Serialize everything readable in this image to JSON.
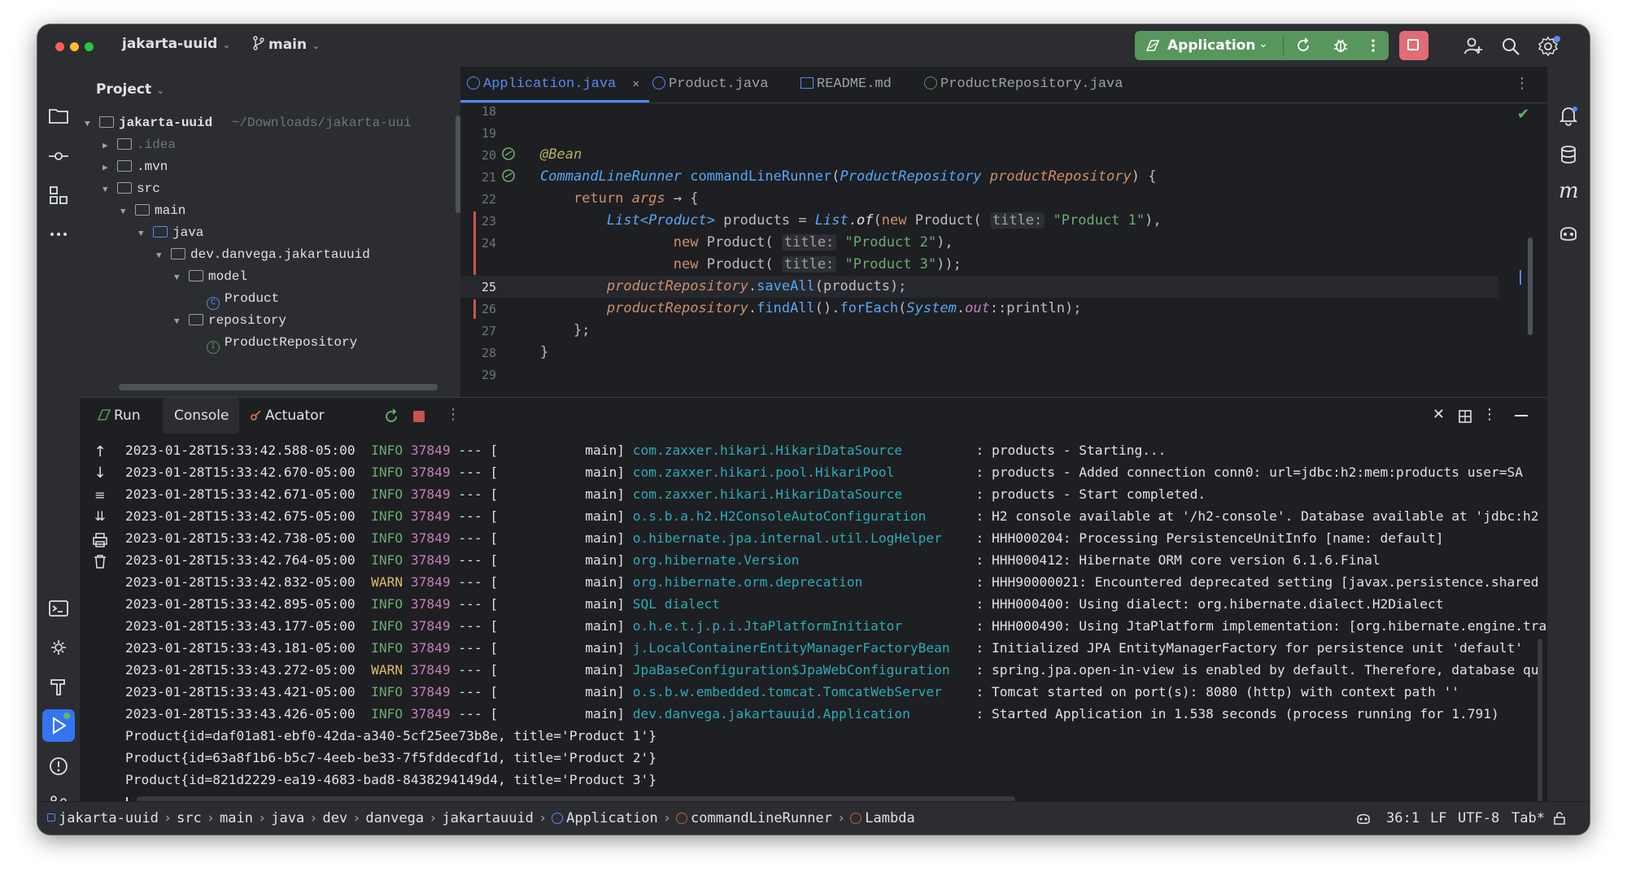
{
  "titlebar": {
    "project_name": "jakarta-uuid",
    "branch": "main",
    "run_config": "Application"
  },
  "project_pane": {
    "title": "Project",
    "root_name": "jakarta-uuid",
    "root_path": "~/Downloads/jakarta-uui",
    "items": [
      {
        "label": ".idea"
      },
      {
        "label": ".mvn"
      },
      {
        "label": "src"
      },
      {
        "label": "main"
      },
      {
        "label": "java"
      },
      {
        "label": "dev.danvega.jakartauuid"
      },
      {
        "label": "model"
      },
      {
        "label": "Product"
      },
      {
        "label": "repository"
      },
      {
        "label": "ProductRepository"
      }
    ]
  },
  "editor": {
    "tabs": [
      {
        "label": "Application.java"
      },
      {
        "label": "Product.java"
      },
      {
        "label": "README.md"
      },
      {
        "label": "ProductRepository.java"
      }
    ],
    "line_numbers": [
      "18",
      "19",
      "20",
      "21",
      "22",
      "23",
      "24",
      "25",
      "26",
      "27",
      "28",
      "29"
    ],
    "code": {
      "l19": "@Bean",
      "l20_type": "CommandLineRunner",
      "l20_fn": "commandLineRunner",
      "l20_paramtype": "ProductRepository",
      "l20_param": "productRepository",
      "l21_kw": "return",
      "l21_args": "args",
      "l22_type": "List<Product>",
      "l22_var": "products",
      "l22_list": "List",
      "l22_of": "of",
      "hint_title": "title:",
      "p1": "\"Product 1\"",
      "p2": "\"Product 2\"",
      "p3": "\"Product 3\"",
      "new_kw": "new",
      "product_cls": "Product",
      "l25_recv": "productRepository",
      "l25_call": "saveAll",
      "l25_arg": "products",
      "l26_recv": "productRepository",
      "l26_findall": "findAll",
      "l26_foreach": "forEach",
      "l26_system": "System",
      "l26_out": "out",
      "l26_println": "println"
    }
  },
  "toolwindow": {
    "tabs": [
      {
        "label": "Run"
      },
      {
        "label": "Console"
      },
      {
        "label": "Actuator"
      }
    ],
    "log_lines": [
      {
        "ts": "2023-01-28T15:33:42.588-05:00",
        "level": "INFO",
        "pid": "37849",
        "thread": "main",
        "logger": "com.zaxxer.hikari.HikariDataSource",
        "msg": ": products - Starting..."
      },
      {
        "ts": "2023-01-28T15:33:42.670-05:00",
        "level": "INFO",
        "pid": "37849",
        "thread": "main",
        "logger": "com.zaxxer.hikari.pool.HikariPool",
        "msg": ": products - Added connection conn0: url=jdbc:h2:mem:products user=SA"
      },
      {
        "ts": "2023-01-28T15:33:42.671-05:00",
        "level": "INFO",
        "pid": "37849",
        "thread": "main",
        "logger": "com.zaxxer.hikari.HikariDataSource",
        "msg": ": products - Start completed."
      },
      {
        "ts": "2023-01-28T15:33:42.675-05:00",
        "level": "INFO",
        "pid": "37849",
        "thread": "main",
        "logger": "o.s.b.a.h2.H2ConsoleAutoConfiguration",
        "msg": ": H2 console available at '/h2-console'. Database available at 'jdbc:h2"
      },
      {
        "ts": "2023-01-28T15:33:42.738-05:00",
        "level": "INFO",
        "pid": "37849",
        "thread": "main",
        "logger": "o.hibernate.jpa.internal.util.LogHelper",
        "msg": ": HHH000204: Processing PersistenceUnitInfo [name: default]"
      },
      {
        "ts": "2023-01-28T15:33:42.764-05:00",
        "level": "INFO",
        "pid": "37849",
        "thread": "main",
        "logger": "org.hibernate.Version",
        "msg": ": HHH000412: Hibernate ORM core version 6.1.6.Final"
      },
      {
        "ts": "2023-01-28T15:33:42.832-05:00",
        "level": "WARN",
        "pid": "37849",
        "thread": "main",
        "logger": "org.hibernate.orm.deprecation",
        "msg": ": HHH90000021: Encountered deprecated setting [javax.persistence.shared"
      },
      {
        "ts": "2023-01-28T15:33:42.895-05:00",
        "level": "INFO",
        "pid": "37849",
        "thread": "main",
        "logger": "SQL dialect",
        "msg": ": HHH000400: Using dialect: org.hibernate.dialect.H2Dialect"
      },
      {
        "ts": "2023-01-28T15:33:43.177-05:00",
        "level": "INFO",
        "pid": "37849",
        "thread": "main",
        "logger": "o.h.e.t.j.p.i.JtaPlatformInitiator",
        "msg": ": HHH000490: Using JtaPlatform implementation: [org.hibernate.engine.tra"
      },
      {
        "ts": "2023-01-28T15:33:43.181-05:00",
        "level": "INFO",
        "pid": "37849",
        "thread": "main",
        "logger": "j.LocalContainerEntityManagerFactoryBean",
        "msg": ": Initialized JPA EntityManagerFactory for persistence unit 'default'"
      },
      {
        "ts": "2023-01-28T15:33:43.272-05:00",
        "level": "WARN",
        "pid": "37849",
        "thread": "main",
        "logger": "JpaBaseConfiguration$JpaWebConfiguration",
        "msg": ": spring.jpa.open-in-view is enabled by default. Therefore, database qu"
      },
      {
        "ts": "2023-01-28T15:33:43.421-05:00",
        "level": "INFO",
        "pid": "37849",
        "thread": "main",
        "logger": "o.s.b.w.embedded.tomcat.TomcatWebServer",
        "msg": ": Tomcat started on port(s): 8080 (http) with context path ''"
      },
      {
        "ts": "2023-01-28T15:33:43.426-05:00",
        "level": "INFO",
        "pid": "37849",
        "thread": "main",
        "logger": "dev.danvega.jakartauuid.Application",
        "msg": ": Started Application in 1.538 seconds (process running for 1.791)"
      }
    ],
    "output_lines": [
      "Product{id=daf01a81-ebf0-42da-a340-5cf25ee73b8e, title='Product 1'}",
      "Product{id=63a8f1b6-b5c7-4eeb-be33-7f5fddecdf1d, title='Product 2'}",
      "Product{id=821d2229-ea19-4683-bad8-8438294149d4, title='Product 3'}"
    ]
  },
  "statusbar": {
    "breadcrumbs": [
      "jakarta-uuid",
      "src",
      "main",
      "java",
      "dev",
      "danvega",
      "jakartauuid",
      "Application",
      "commandLineRunner",
      "Lambda"
    ],
    "position": "36:1",
    "line_ending": "LF",
    "encoding": "UTF-8",
    "indent": "Tab*"
  },
  "colors": {
    "accent": "#548af7",
    "run_green": "#57965c",
    "stop_red": "#e06c75",
    "info": "#6aab73",
    "warn": "#e0bb65"
  }
}
